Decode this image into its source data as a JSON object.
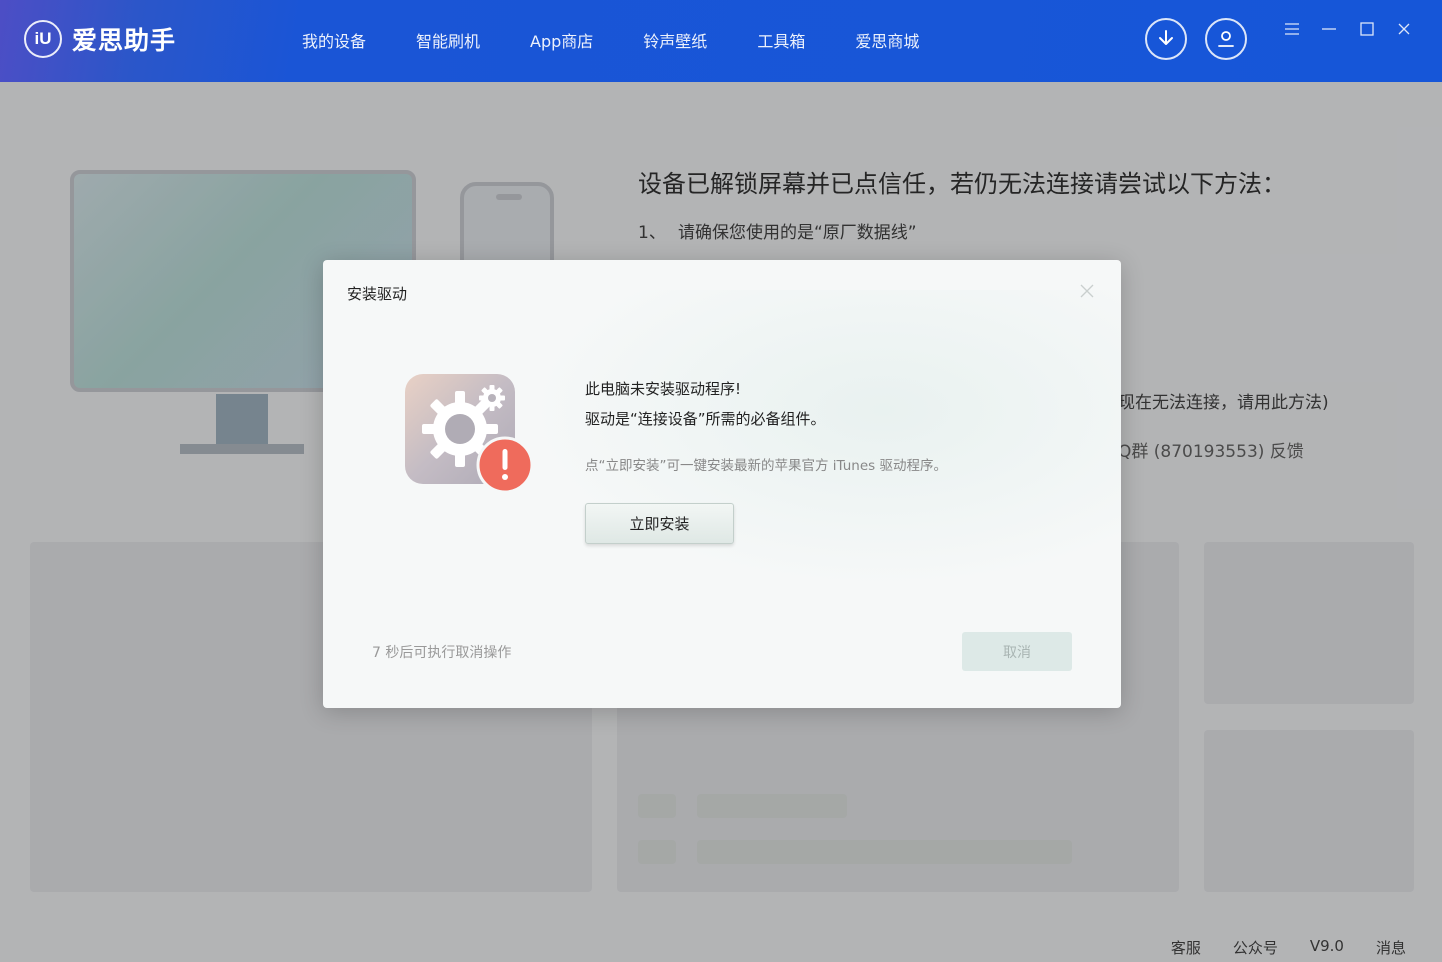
{
  "app": {
    "logo_badge": "iU",
    "logo_text": "爱思助手"
  },
  "nav": [
    {
      "label": "我的设备"
    },
    {
      "label": "智能刷机"
    },
    {
      "label": "App商店"
    },
    {
      "label": "铃声壁纸"
    },
    {
      "label": "工具箱"
    },
    {
      "label": "爱思商城"
    }
  ],
  "header_icons": [
    "download-icon",
    "user-icon",
    "menu-icon",
    "minimize-icon",
    "maximize-icon",
    "close-icon"
  ],
  "background": {
    "tips_title": "设备已解锁屏幕并已点信任，若仍无法连接请尝试以下方法：",
    "tip1_index": "1、",
    "tip1_text": "请确保您使用的是“原厂数据线”",
    "tip_partial_1": "现在无法连接，请用此方法)",
    "tip_partial_2": "Q群 (870193553) 反馈"
  },
  "footer": {
    "support": "客服",
    "official_account": "公众号",
    "version": "V9.0",
    "messages": "消息"
  },
  "dialog": {
    "title": "安装驱动",
    "message_line1": "此电脑未安装驱动程序!",
    "message_line2": "驱动是“连接设备”所需的必备组件。",
    "hint": "点“立即安装”可一键安装最新的苹果官方 iTunes 驱动程序。",
    "install_label": "立即安装",
    "countdown": "7 秒后可执行取消操作",
    "cancel_label": "取消"
  },
  "colors": {
    "header": "#1656d8",
    "alert_badge": "#ef6b5c",
    "gear_tile_start": "#e6cfc3",
    "gear_tile_end": "#b9b4bd"
  }
}
